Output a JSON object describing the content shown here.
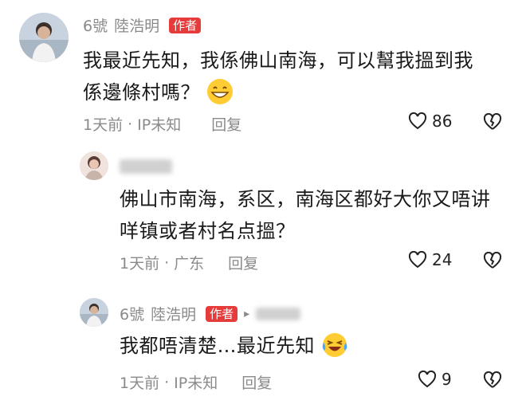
{
  "comments": [
    {
      "user": "6號",
      "user_handle": "陸浩明",
      "badge": "作者",
      "text": "我最近先知，我係佛山南海，可以幫我搵到我係邊條村嗎？",
      "meta_time": "1天前",
      "meta_location": "IP未知",
      "reply_label": "回复",
      "likes": "86",
      "emoji": "grin-emoji"
    },
    {
      "user": "",
      "text_line1": "佛山市南海，系区，南海区都好大你又唔讲",
      "text_line2": "咩镇或者村名点搵？",
      "meta_time": "1天前",
      "meta_location": "广东",
      "reply_label": "回复",
      "likes": "24"
    },
    {
      "user": "6號",
      "user_handle": "陸浩明",
      "badge": "作者",
      "text": "我都唔清楚…最近先知",
      "meta_time": "1天前",
      "meta_location": "IP未知",
      "reply_label": "回复",
      "likes": "9",
      "emoji": "laughing-tears-emoji"
    }
  ],
  "colors": {
    "badge": "#e63b3b",
    "muted": "#8a8a8a",
    "text": "#1a1a1a"
  }
}
